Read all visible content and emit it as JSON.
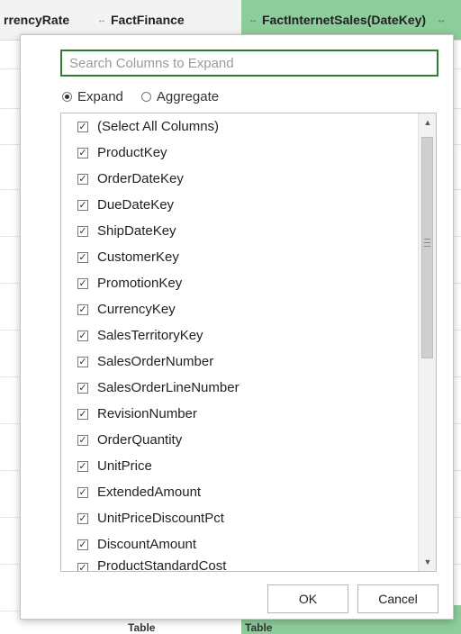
{
  "header": {
    "columns": [
      {
        "label": "rrencyRate",
        "icon": "expand-arrows-icon"
      },
      {
        "label": "FactFinance",
        "icon": "expand-arrows-icon"
      },
      {
        "label": "FactInternetSales(DateKey)",
        "icon": "expand-arrows-icon"
      }
    ],
    "active_color": "#8dcc9b"
  },
  "dialog": {
    "search": {
      "placeholder": "Search Columns to Expand",
      "value": ""
    },
    "mode": {
      "options": [
        "Expand",
        "Aggregate"
      ],
      "selected": "Expand"
    },
    "columns": [
      {
        "label": "(Select All Columns)",
        "checked": true
      },
      {
        "label": "ProductKey",
        "checked": true
      },
      {
        "label": "OrderDateKey",
        "checked": true
      },
      {
        "label": "DueDateKey",
        "checked": true
      },
      {
        "label": "ShipDateKey",
        "checked": true
      },
      {
        "label": "CustomerKey",
        "checked": true
      },
      {
        "label": "PromotionKey",
        "checked": true
      },
      {
        "label": "CurrencyKey",
        "checked": true
      },
      {
        "label": "SalesTerritoryKey",
        "checked": true
      },
      {
        "label": "SalesOrderNumber",
        "checked": true
      },
      {
        "label": "SalesOrderLineNumber",
        "checked": true
      },
      {
        "label": "RevisionNumber",
        "checked": true
      },
      {
        "label": "OrderQuantity",
        "checked": true
      },
      {
        "label": "UnitPrice",
        "checked": true
      },
      {
        "label": "ExtendedAmount",
        "checked": true
      },
      {
        "label": "UnitPriceDiscountPct",
        "checked": true
      },
      {
        "label": "DiscountAmount",
        "checked": true
      },
      {
        "label": "ProductStandardCost",
        "checked": true
      }
    ],
    "ok_label": "OK",
    "cancel_label": "Cancel"
  },
  "background": {
    "cells": [
      "Table",
      "Table"
    ]
  },
  "colors": {
    "accent": "#2e7d32",
    "header_active": "#8dcc9b"
  }
}
